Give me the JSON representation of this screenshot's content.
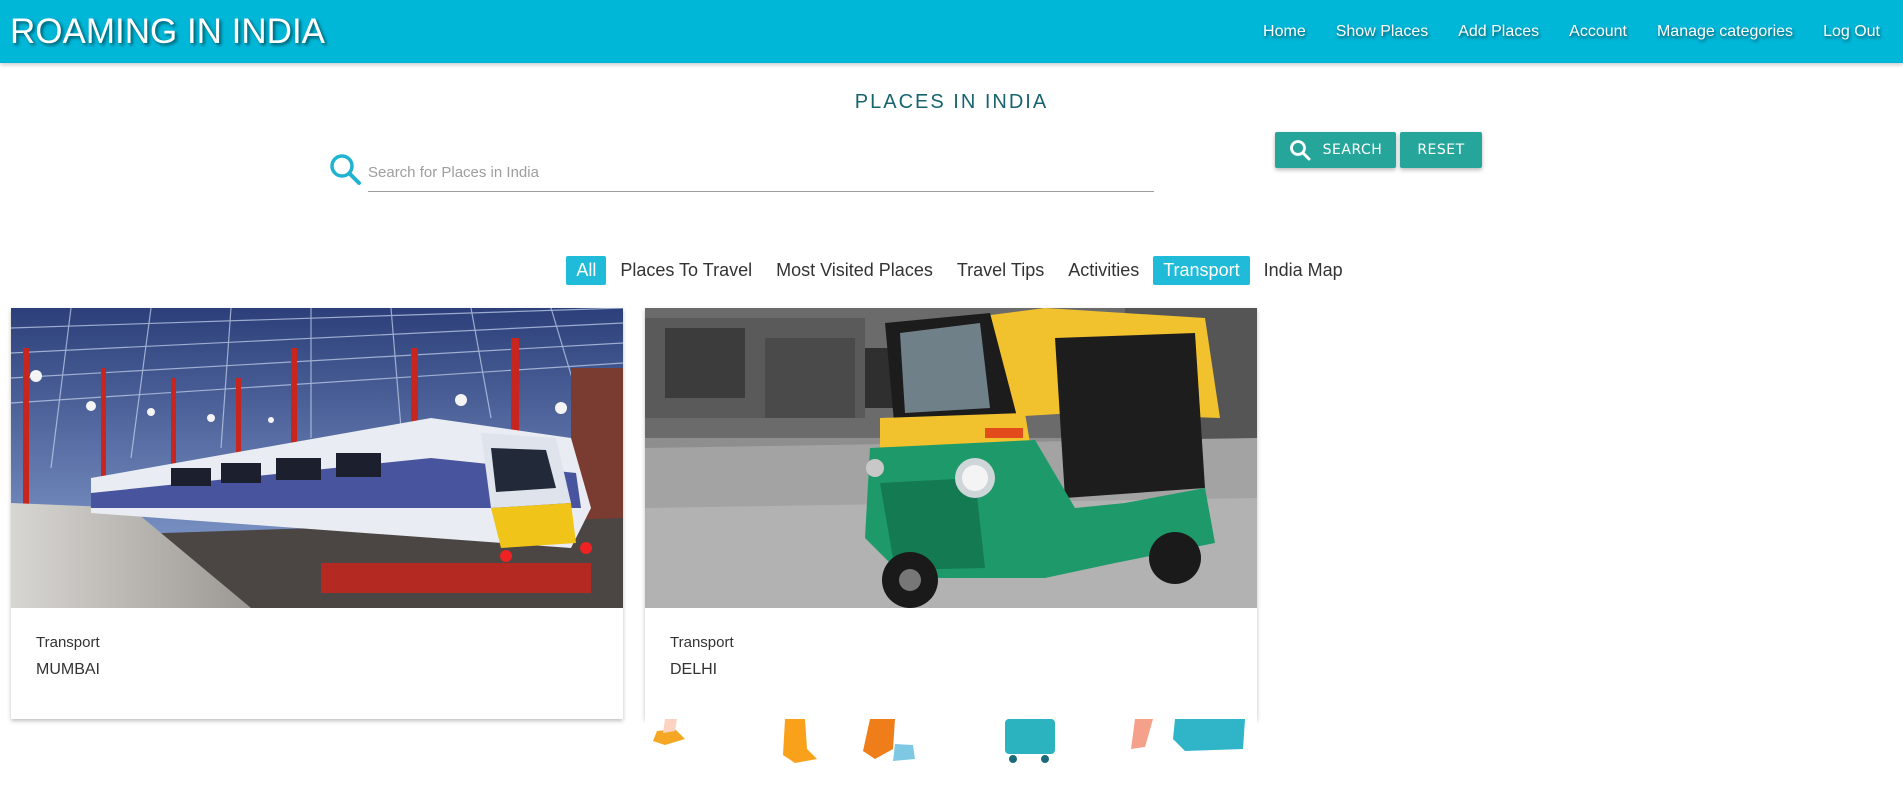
{
  "brand": "ROAMING IN INDIA",
  "nav": {
    "items": [
      "Home",
      "Show Places",
      "Add Places",
      "Account",
      "Manage categories",
      "Log Out"
    ]
  },
  "page_title": "PLACES IN INDIA",
  "search": {
    "placeholder": "Search for Places in India",
    "value": "",
    "search_label": "SEARCH",
    "reset_label": "RESET"
  },
  "tabs": [
    {
      "label": "All",
      "active": true
    },
    {
      "label": "Places To Travel",
      "active": false
    },
    {
      "label": "Most Visited Places",
      "active": false
    },
    {
      "label": "Travel Tips",
      "active": false
    },
    {
      "label": "Activities",
      "active": false
    },
    {
      "label": "Transport",
      "active": true
    },
    {
      "label": "India Map",
      "active": false
    }
  ],
  "cards": [
    {
      "category": "Transport",
      "title": "MUMBAI",
      "image": "train-station-photo"
    },
    {
      "category": "Transport",
      "title": "DELHI",
      "image": "auto-rickshaw-photo"
    }
  ],
  "colors": {
    "navbar": "#00b7d8",
    "accent_button": "#26a69a",
    "active_tab": "#1fbbd8",
    "title_text": "#17646f"
  },
  "icons": {
    "search": "search-icon",
    "search_button": "search-icon"
  }
}
